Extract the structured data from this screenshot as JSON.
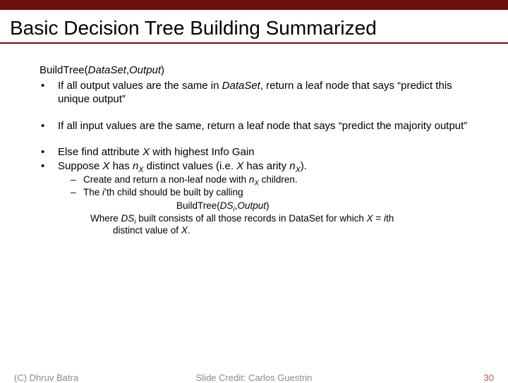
{
  "title": "Basic Decision Tree Building Summarized",
  "func": {
    "pre": "BuildTree(",
    "arg1": "DataSet",
    "mid": ",",
    "arg2": "Output",
    "post": ")"
  },
  "b1": {
    "pre": "If all output values are the same in ",
    "ds": "DataSet",
    "post": ", return a leaf node that says “predict this unique output”"
  },
  "b2": "If all input values are the same, return a leaf node that says “predict the majority output”",
  "b3": {
    "pre": "Else find attribute ",
    "x": "X",
    "post": " with highest Info Gain"
  },
  "b4": {
    "p1": "Suppose ",
    "x1": "X",
    "p2": " has ",
    "n": "n",
    "sub": "X",
    "p3": " distinct values (i.e. ",
    "x2": "X",
    "p4": " has arity ",
    "n2": "n",
    "sub2": "X",
    "p5": ")."
  },
  "d1": {
    "p1": "Create and return a non-leaf node with ",
    "n": "n",
    "sub": "X",
    "p2": " children."
  },
  "d2": {
    "p1": "The ",
    "i": "i",
    "p2": "’th child should be built by calling"
  },
  "call": {
    "p1": "BuildTree(",
    "ds": "DS",
    "sub": "i",
    "mid": ",",
    "out": "Output",
    "p2": ")"
  },
  "where": {
    "p1": "Where ",
    "ds": "DS",
    "sub": "i",
    "p2": " built consists of all those records in DataSet for which ",
    "x": "X",
    "p3": " = ",
    "i": "i",
    "p4": "th"
  },
  "wherecont": {
    "p1": "distinct value of ",
    "x": "X",
    "p2": "."
  },
  "footer": {
    "left": "(C) Dhruv Batra",
    "center": "Slide Credit: Carlos Guestrin",
    "right": "30"
  }
}
